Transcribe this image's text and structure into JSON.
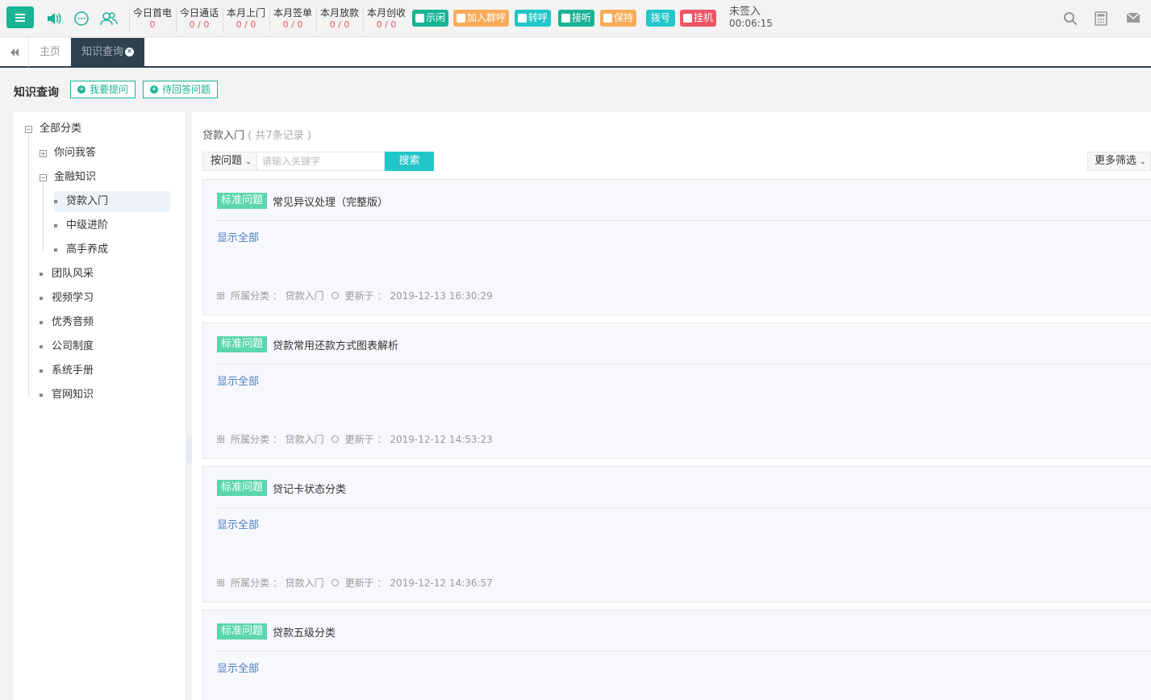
{
  "topbar": {
    "stats": [
      {
        "label": "今日首电",
        "value": "0"
      },
      {
        "label": "今日通话",
        "value": "0 / 0"
      },
      {
        "label": "本月上门",
        "value": "0 / 0"
      },
      {
        "label": "本月签单",
        "value": "0 / 0"
      },
      {
        "label": "本月放款",
        "value": "0 / 0"
      },
      {
        "label": "本月创收",
        "value": "0 / 0"
      }
    ],
    "actions": [
      {
        "label": "示闲",
        "color": "#1ab394"
      },
      {
        "label": "加入群呼",
        "color": "#f8ac59"
      },
      {
        "label": "转呼",
        "color": "#23c6c8"
      },
      {
        "label": "接听",
        "color": "#1ab394"
      },
      {
        "label": "保持",
        "color": "#f8ac59"
      },
      {
        "label": "拨号",
        "color": "#23c6c8"
      },
      {
        "label": "挂机",
        "color": "#ed5565"
      }
    ],
    "sign_status": "未签入",
    "timer": "00:06:15",
    "icons": [
      "menu-icon",
      "speaker-icon",
      "chat-icon",
      "users-icon",
      "search-icon",
      "calculator-icon",
      "mail-icon"
    ]
  },
  "tabs": {
    "home": "主页",
    "active": "知识查询"
  },
  "page": {
    "title": "知识查询",
    "ask_button": "我要提问",
    "pending_button": "待回答问题"
  },
  "tree": {
    "root": "全部分类",
    "items": [
      {
        "label": "你问我答"
      },
      {
        "label": "金融知识"
      },
      {
        "label": "贷款入门"
      },
      {
        "label": "中级进阶"
      },
      {
        "label": "高手养成"
      },
      {
        "label": "团队风采"
      },
      {
        "label": "视频学习"
      },
      {
        "label": "优秀音频"
      },
      {
        "label": "公司制度"
      },
      {
        "label": "系统手册"
      },
      {
        "label": "官网知识"
      }
    ]
  },
  "list": {
    "category": "贷款入门",
    "count_text": "( 共7条记录 )",
    "search_by": "按问题",
    "search_placeholder": "请输入关键字",
    "search_button": "搜索",
    "more_filter": "更多筛选",
    "tag_label": "标准问题",
    "show_all": "显示全部",
    "category_label": "所属分类 ：",
    "updated_label": "更新于 ：",
    "items": [
      {
        "question": "常见异议处理（完整版）",
        "category": "贷款入门",
        "updated": "2019-12-13 16:30:29"
      },
      {
        "question": "贷款常用还款方式图表解析",
        "category": "贷款入门",
        "updated": "2019-12-12 14:53:23"
      },
      {
        "question": "贷记卡状态分类",
        "category": "贷款入门",
        "updated": "2019-12-12 14:36:57"
      },
      {
        "question": "贷款五级分类",
        "category": "",
        "updated": ""
      }
    ]
  }
}
